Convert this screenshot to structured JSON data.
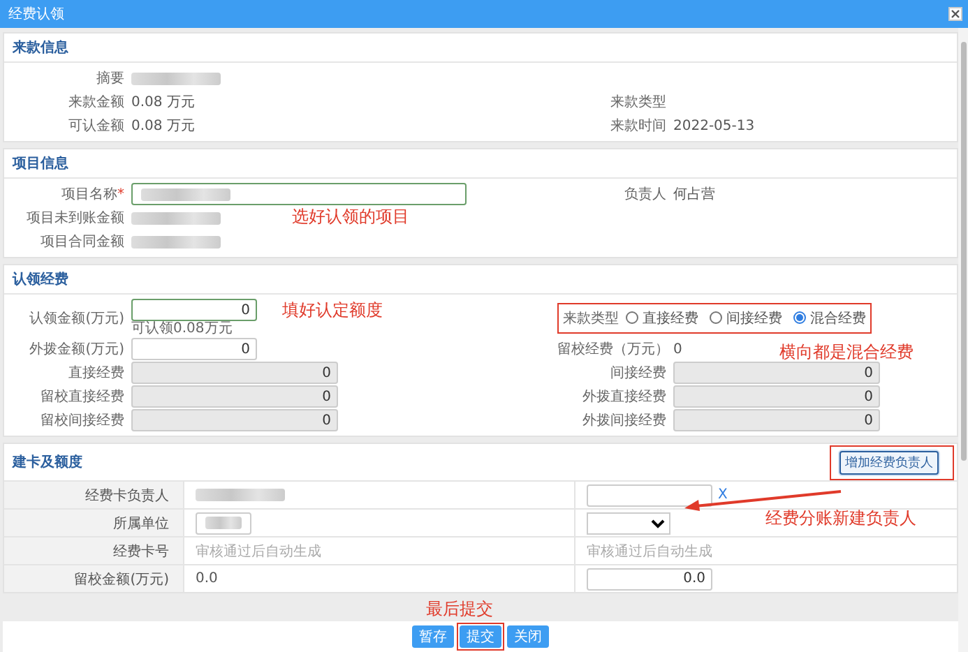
{
  "window": {
    "title": "经费认领"
  },
  "income_section": {
    "title": "来款信息",
    "rows": [
      {
        "left": {
          "label": "摘要",
          "kind": "blurred"
        }
      },
      {
        "left": {
          "label": "来款金额",
          "kind": "text",
          "value": "0.08  万元"
        },
        "right": {
          "label": "来款类型",
          "kind": "empty"
        }
      },
      {
        "left": {
          "label": "可认金额",
          "kind": "text",
          "value": "0.08  万元"
        },
        "right": {
          "label": "来款时间",
          "kind": "text",
          "value": "2022-05-13"
        }
      }
    ]
  },
  "project_section": {
    "title": "项目信息",
    "rows": [
      {
        "left": {
          "label": "项目名称",
          "mark": "*",
          "kind": "blurred-input",
          "focused": true,
          "note": "选好认领的项目"
        },
        "right": {
          "label": "负责人",
          "kind": "text",
          "value": "何占营"
        }
      },
      {
        "left": {
          "label": "项目未到账金额",
          "kind": "blurred"
        }
      },
      {
        "left": {
          "label": "项目合同金额",
          "kind": "blurred"
        }
      }
    ]
  },
  "claim_section": {
    "title": "认领经费",
    "rows": [
      {
        "left": {
          "label": "认领金额(万元)",
          "kind": "input",
          "value": "0",
          "focused": true,
          "hint": "可认领0.08万元",
          "note": "填好认定额度"
        },
        "right": {
          "label": "来款类型",
          "kind": "radio",
          "options": [
            {
              "label": "直接经费",
              "selected": false
            },
            {
              "label": "间接经费",
              "selected": false
            },
            {
              "label": "混合经费",
              "selected": true
            }
          ],
          "note": "横向都是混合经费",
          "highlighted": true
        }
      },
      {
        "left": {
          "label": "外拨金额(万元)",
          "kind": "input",
          "value": "0",
          "focused": false
        },
        "right": {
          "label": "留校经费（万元）",
          "kind": "text",
          "value": "0"
        }
      },
      {
        "left": {
          "label": "直接经费",
          "kind": "readonly",
          "value": "0"
        },
        "right": {
          "label": "间接经费",
          "kind": "readonly",
          "value": "0"
        }
      },
      {
        "left": {
          "label": "留校直接经费",
          "kind": "readonly",
          "value": "0"
        },
        "right": {
          "label": "外拨直接经费",
          "kind": "readonly",
          "value": "0"
        }
      },
      {
        "left": {
          "label": "留校间接经费",
          "kind": "readonly",
          "value": "0"
        },
        "right": {
          "label": "外拨间接经费",
          "kind": "readonly",
          "value": "0"
        }
      }
    ]
  },
  "card_section": {
    "title": "建卡及额度",
    "action": {
      "label": "增加经费负责人",
      "highlighted": true
    },
    "rows": [
      {
        "label": "经费卡负责人",
        "left": {
          "kind": "blurred"
        },
        "right": {
          "kind": "input",
          "clear": "X"
        }
      },
      {
        "label": "所属单位",
        "left": {
          "kind": "blurred-input"
        },
        "right": {
          "kind": "select",
          "note": "经费分账新建负责人"
        }
      },
      {
        "label": "经费卡号",
        "left": {
          "kind": "muted",
          "value": "审核通过后自动生成"
        },
        "right": {
          "kind": "muted",
          "value": "审核通过后自动生成"
        }
      },
      {
        "label": "留校金额(万元)",
        "left": {
          "kind": "text",
          "value": "0.0"
        },
        "right": {
          "kind": "input",
          "value": "0.0"
        }
      }
    ]
  },
  "footer": {
    "buttons": [
      {
        "label": "暂存",
        "highlighted": false
      },
      {
        "label": "提交",
        "highlighted": true,
        "note": "最后提交"
      },
      {
        "label": "关闭",
        "highlighted": false
      }
    ]
  }
}
